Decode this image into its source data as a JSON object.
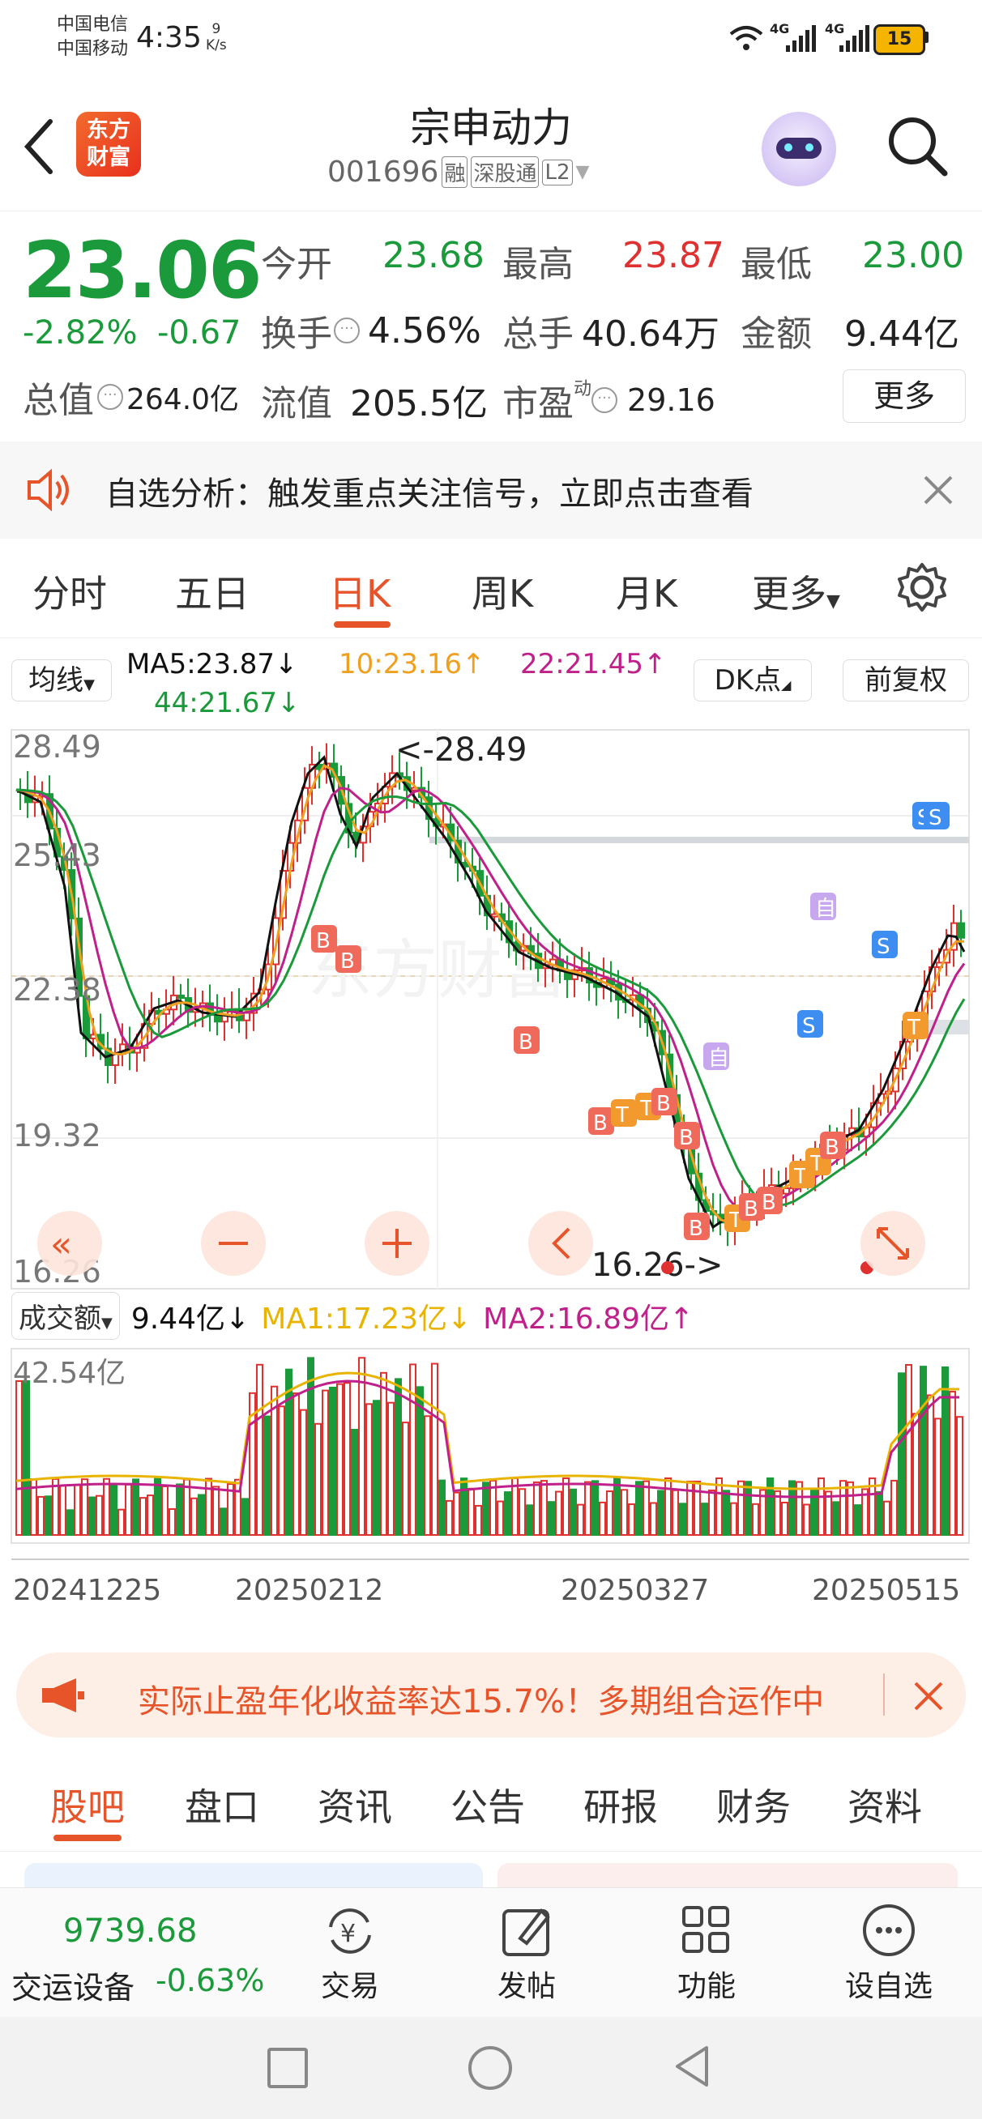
{
  "status_bar": {
    "carrier1": "中国电信",
    "carrier2": "中国移动",
    "time": "4:35",
    "speed_value": "9",
    "speed_unit": "K/s",
    "signal1": "4G",
    "signal2": "4G",
    "battery": "15"
  },
  "header": {
    "app_logo_line1": "东方",
    "app_logo_line2": "财富",
    "title": "宗申动力",
    "code": "001696",
    "badge_rong": "融",
    "badge_sgt": "深股通",
    "badge_level": "L2",
    "back_icon": "chevron-left-icon",
    "search_icon": "search-icon"
  },
  "quote": {
    "price": "23.06",
    "change_pct": "-2.82%",
    "change_abs": "-0.67",
    "open_label": "今开",
    "open_value": "23.68",
    "high_label": "最高",
    "high_value": "23.87",
    "low_label": "最低",
    "low_value": "23.00",
    "turnover_label": "换手",
    "turnover_value": "4.56%",
    "volume_label": "总手",
    "volume_value": "40.64万",
    "amount_label": "金额",
    "amount_value": "9.44亿",
    "mktcap_label": "总值",
    "mktcap_value": "264.0亿",
    "float_label": "流值",
    "float_value": "205.5亿",
    "pe_label": "市盈",
    "pe_sup": "动",
    "pe_value": "29.16",
    "more_button": "更多"
  },
  "notice": {
    "text": "自选分析：触发重点关注信号，立即点击查看"
  },
  "chart_tabs": [
    "分时",
    "五日",
    "日K",
    "周K",
    "月K",
    "更多"
  ],
  "active_tab": "日K",
  "ma_line": {
    "selector": "均线",
    "ma5": "MA5:23.87",
    "ma10": "10:23.16",
    "ma22": "22:21.45",
    "ma44": "44:21.67",
    "dk_button": "DK点",
    "adjust_button": "前复权"
  },
  "kline": {
    "y_labels": [
      "28.49",
      "25.43",
      "22.38",
      "19.32",
      "16.26"
    ],
    "high_marker": "<-28.49",
    "low_marker": "16.26->",
    "watermark": "东方财富",
    "colors": {
      "up": "#e03131",
      "down": "#1a9a3a",
      "ma5": "#111111",
      "ma10": "#f0a020",
      "ma22": "#c0208a",
      "ma44": "#1a9a3a"
    }
  },
  "volume": {
    "selector": "成交额",
    "current": "9.44亿",
    "ma1": "MA1:17.23亿",
    "ma2": "MA2:16.89亿",
    "max_label": "42.54亿",
    "dates": [
      "20241225",
      "20250212",
      "20250327",
      "20250515"
    ]
  },
  "banner": {
    "text": "实际止盈年化收益率达15.7%！多期组合运作中"
  },
  "bottom_tabs": [
    "股吧",
    "盘口",
    "资讯",
    "公告",
    "研报",
    "财务",
    "资料"
  ],
  "bottom_active": "股吧",
  "bottom_bar": {
    "index_value": "9739.68",
    "index_name": "交运设备",
    "index_change": "-0.63%",
    "items": [
      "交易",
      "发帖",
      "功能",
      "设自选"
    ]
  }
}
